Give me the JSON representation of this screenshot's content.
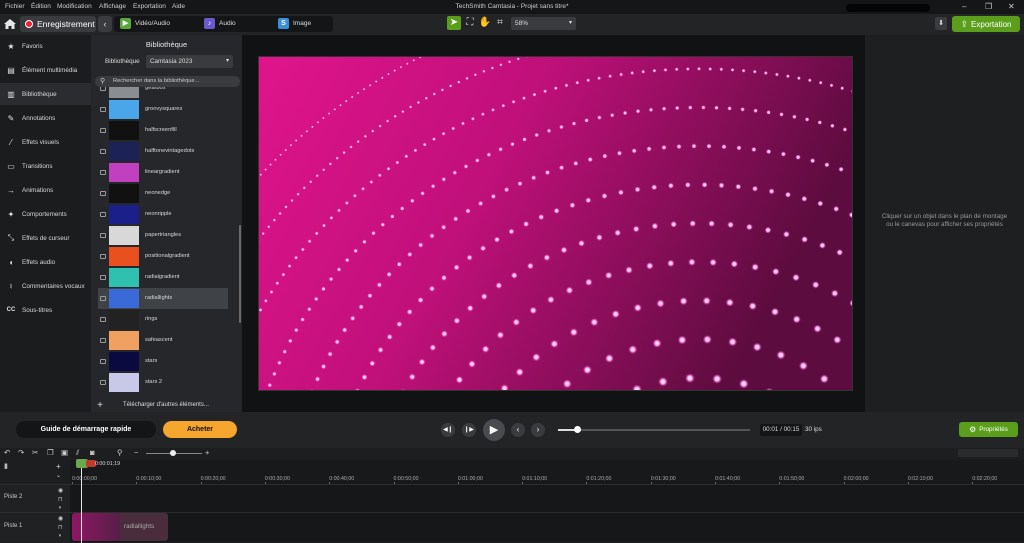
{
  "menu": [
    "Fichier",
    "Édition",
    "Modification",
    "Affichage",
    "Exportation",
    "Aide"
  ],
  "app_title": "TechSmith Camtasia - Projet sans titre*",
  "toolbar": {
    "record_label": "Enregistrement",
    "media_tabs": [
      {
        "label": "Vidéo/Audio",
        "icon": "video-icon",
        "color": "#5aa83a"
      },
      {
        "label": "Audio",
        "icon": "audio-icon",
        "color": "#6a5acd"
      },
      {
        "label": "Image",
        "icon": "image-icon",
        "color": "#3a8fd9"
      }
    ],
    "zoom": "58%",
    "export_label": "Exportation"
  },
  "sidebar": {
    "items": [
      {
        "label": "Favoris",
        "icon": "star-icon"
      },
      {
        "label": "Élément multimédia",
        "icon": "film-icon"
      },
      {
        "label": "Bibliothèque",
        "icon": "library-icon",
        "active": true
      },
      {
        "label": "Annotations",
        "icon": "annotation-icon"
      },
      {
        "label": "Effets visuels",
        "icon": "magic-wand-icon"
      },
      {
        "label": "Transitions",
        "icon": "transition-icon"
      },
      {
        "label": "Animations",
        "icon": "animation-icon"
      },
      {
        "label": "Comportements",
        "icon": "behavior-icon"
      },
      {
        "label": "Effets de curseur",
        "icon": "cursor-icon"
      },
      {
        "label": "Effets audio",
        "icon": "audio-effects-icon"
      },
      {
        "label": "Commentaires vocaux",
        "icon": "microphone-icon"
      },
      {
        "label": "Sous-titres",
        "icon": "captions-icon"
      }
    ]
  },
  "library": {
    "title": "Bibliothèque",
    "label": "Bibliothèque",
    "selected": "Camtasia 2023",
    "search_placeholder": "Rechercher dans la bibliothèque...",
    "items": [
      {
        "name": "gearbox",
        "thumb": "#8a8d92"
      },
      {
        "name": "groovysquares",
        "thumb": "#4aa6e8"
      },
      {
        "name": "halfscreenfill",
        "thumb": "#111111"
      },
      {
        "name": "halftonevintagedots",
        "thumb": "#1c2255"
      },
      {
        "name": "lineargradient",
        "thumb": "#c040c0"
      },
      {
        "name": "neonedge",
        "thumb": "#111111"
      },
      {
        "name": "neonripple",
        "thumb": "#1a1f8a"
      },
      {
        "name": "papertriangles",
        "thumb": "#d8d8d8"
      },
      {
        "name": "positionalgradient",
        "thumb": "#e85020"
      },
      {
        "name": "radialgradient",
        "thumb": "#30c0b0"
      },
      {
        "name": "radiallights",
        "thumb": "#3a6ad8",
        "selected": true
      },
      {
        "name": "rings",
        "thumb": "#222222"
      },
      {
        "name": "safeascent",
        "thumb": "#f0a060"
      },
      {
        "name": "stars",
        "thumb": "#0a0a40"
      },
      {
        "name": "stars 2",
        "thumb": "#c8c8e8"
      }
    ],
    "download_more": "Télécharger d'autres éléments..."
  },
  "properties_hint": "Cliquer sur un objet dans le plan de montage ou le canevas pour afficher ses propriétés",
  "transport": {
    "guide_label": "Guide de démarrage rapide",
    "buy_label": "Acheter",
    "progress": 0.1,
    "timecode": "00:01 / 00:15",
    "fps": "30 ips",
    "properties_label": "Propriétés"
  },
  "timeline": {
    "playhead_time": "0:00:01;19",
    "ticks": [
      "0:00:00;00",
      "0:00:10;00",
      "0:00:20;00",
      "0:00:30;00",
      "0:00:40;00",
      "0:00:50;00",
      "0:01:00;00",
      "0:01:10;00",
      "0:01:20;00",
      "0:01:30;00",
      "0:01:40;00",
      "0:01:50;00",
      "0:02:00;00",
      "0:02:10;00",
      "0:02:20;00"
    ],
    "tracks": [
      {
        "name": "Piste 2"
      },
      {
        "name": "Piste 1",
        "clip": "radiallights"
      }
    ]
  }
}
